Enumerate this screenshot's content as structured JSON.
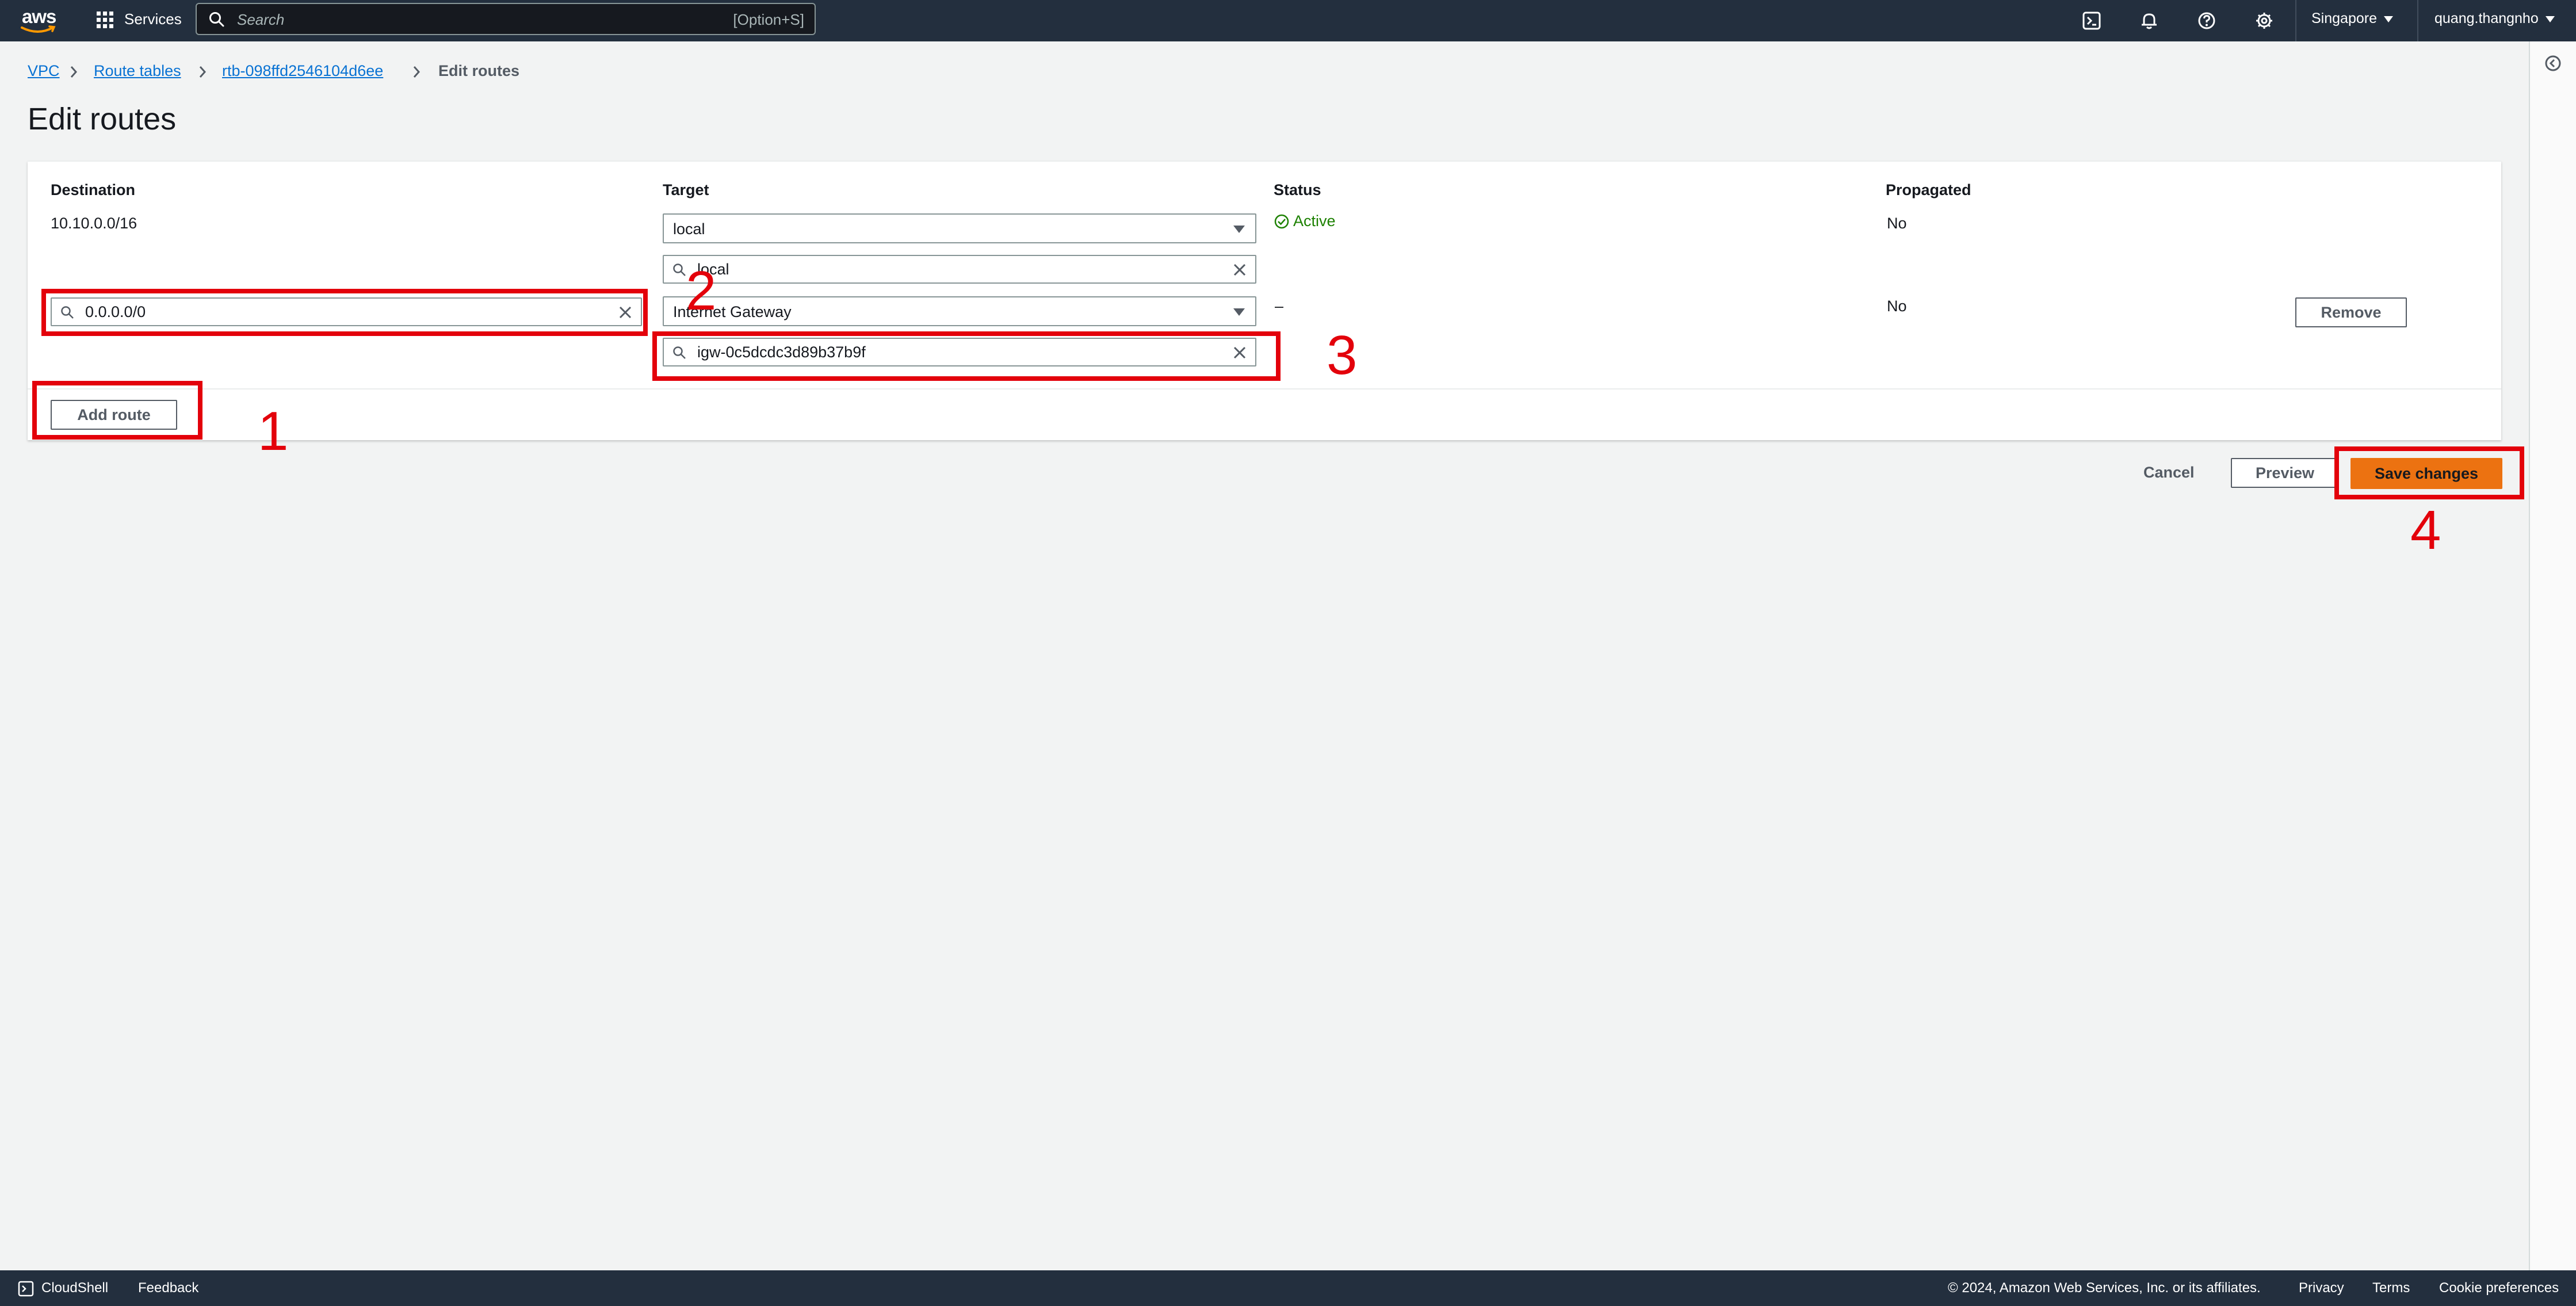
{
  "topnav": {
    "logo_text": "aws",
    "services_label": "Services",
    "search_placeholder": "Search",
    "search_shortcut": "[Option+S]",
    "region": "Singapore",
    "user": "quang.thangnho",
    "icons": [
      "cloudshell-icon",
      "bell-icon",
      "help-icon",
      "gear-icon"
    ]
  },
  "breadcrumb": {
    "items": [
      "VPC",
      "Route tables",
      "rtb-098ffd2546104d6ee"
    ],
    "current": "Edit routes"
  },
  "page_title": "Edit routes",
  "routes": {
    "headers": {
      "destination": "Destination",
      "target": "Target",
      "status": "Status",
      "propagated": "Propagated"
    },
    "rows": [
      {
        "destination": "10.10.0.0/16",
        "target_type": "local",
        "target_search": "local",
        "status": "Active",
        "propagated": "No"
      },
      {
        "destination": "0.0.0.0/0",
        "target_type": "Internet Gateway",
        "target_search": "igw-0c5dcdc3d89b37b9f",
        "status": "–",
        "propagated": "No",
        "remove_label": "Remove"
      }
    ],
    "add_route_label": "Add route"
  },
  "actions": {
    "cancel": "Cancel",
    "preview": "Preview",
    "save": "Save changes"
  },
  "annotations": [
    "1",
    "2",
    "3",
    "4"
  ],
  "footer": {
    "cloudshell": "CloudShell",
    "feedback": "Feedback",
    "copyright": "© 2024, Amazon Web Services, Inc. or its affiliates.",
    "privacy": "Privacy",
    "terms": "Terms",
    "cookies": "Cookie preferences"
  },
  "colors": {
    "nav_bg": "#232f3e",
    "link": "#0972d3",
    "primary": "#ec7211",
    "success": "#1d8102",
    "annotation": "#e3010b"
  }
}
